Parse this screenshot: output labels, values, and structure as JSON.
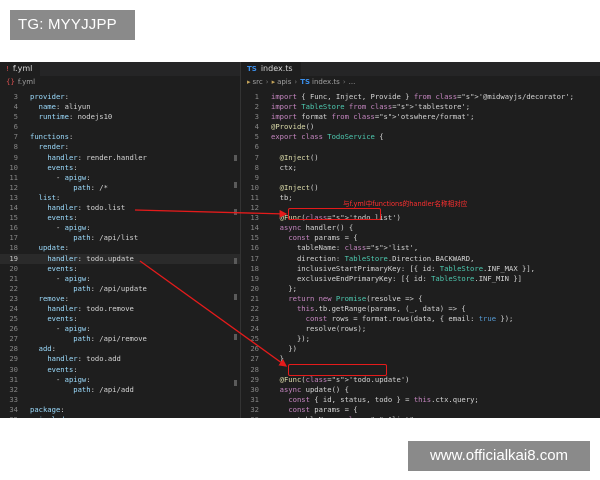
{
  "watermarks": {
    "top_left": "TG: MYYJJPP",
    "bottom_right": "www.officialkai8.com"
  },
  "left_editor": {
    "tab_label": "f.yml",
    "breadcrumb": "f.yml",
    "lines": [
      {
        "n": "3",
        "text": "provider:"
      },
      {
        "n": "4",
        "text": "  name: aliyun"
      },
      {
        "n": "5",
        "text": "  runtime: nodejs10"
      },
      {
        "n": "6",
        "text": ""
      },
      {
        "n": "7",
        "text": "functions:"
      },
      {
        "n": "8",
        "text": "  render:"
      },
      {
        "n": "9",
        "text": "    handler: render.handler"
      },
      {
        "n": "10",
        "text": "    events:"
      },
      {
        "n": "11",
        "text": "      - apigw:"
      },
      {
        "n": "12",
        "text": "          path: /*"
      },
      {
        "n": "13",
        "text": "  list:"
      },
      {
        "n": "14",
        "text": "    handler: todo.list"
      },
      {
        "n": "15",
        "text": "    events:"
      },
      {
        "n": "16",
        "text": "      - apigw:"
      },
      {
        "n": "17",
        "text": "          path: /api/list"
      },
      {
        "n": "18",
        "text": "  update:"
      },
      {
        "n": "19",
        "text": "    handler: todo.update"
      },
      {
        "n": "20",
        "text": "    events:"
      },
      {
        "n": "21",
        "text": "      - apigw:"
      },
      {
        "n": "22",
        "text": "          path: /api/update"
      },
      {
        "n": "23",
        "text": "  remove:"
      },
      {
        "n": "24",
        "text": "    handler: todo.remove"
      },
      {
        "n": "25",
        "text": "    events:"
      },
      {
        "n": "26",
        "text": "      - apigw:"
      },
      {
        "n": "27",
        "text": "          path: /api/remove"
      },
      {
        "n": "28",
        "text": "  add:"
      },
      {
        "n": "29",
        "text": "    handler: todo.add"
      },
      {
        "n": "30",
        "text": "    events:"
      },
      {
        "n": "31",
        "text": "      - apigw:"
      },
      {
        "n": "32",
        "text": "          path: /api/add"
      },
      {
        "n": "33",
        "text": ""
      },
      {
        "n": "34",
        "text": "package:"
      },
      {
        "n": "35",
        "text": "  include:"
      }
    ]
  },
  "right_editor": {
    "tab_label": "index.ts",
    "breadcrumb": {
      "src": "src",
      "apis": "apis",
      "file": "index.ts",
      "more": "..."
    },
    "annotation": "与f.yml中functions的handler名称相对应",
    "lines": [
      {
        "n": "1",
        "text": "import { Func, Inject, Provide } from '@midwayjs/decorator';"
      },
      {
        "n": "2",
        "text": "import TableStore from 'tablestore';"
      },
      {
        "n": "3",
        "text": "import format from 'otswhere/format';"
      },
      {
        "n": "4",
        "text": "@Provide()"
      },
      {
        "n": "5",
        "text": "export class TodoService {"
      },
      {
        "n": "6",
        "text": ""
      },
      {
        "n": "7",
        "text": "  @Inject()"
      },
      {
        "n": "8",
        "text": "  ctx;"
      },
      {
        "n": "9",
        "text": ""
      },
      {
        "n": "10",
        "text": "  @Inject()"
      },
      {
        "n": "11",
        "text": "  tb;"
      },
      {
        "n": "12",
        "text": ""
      },
      {
        "n": "13",
        "text": "  @Func('todo.list')"
      },
      {
        "n": "14",
        "text": "  async handler() {"
      },
      {
        "n": "15",
        "text": "    const params = {"
      },
      {
        "n": "16",
        "text": "      tableName: 'list',"
      },
      {
        "n": "17",
        "text": "      direction: TableStore.Direction.BACKWARD,"
      },
      {
        "n": "18",
        "text": "      inclusiveStartPrimaryKey: [{ id: TableStore.INF_MAX }],"
      },
      {
        "n": "19",
        "text": "      exclusiveEndPrimaryKey: [{ id: TableStore.INF_MIN }]"
      },
      {
        "n": "20",
        "text": "    };"
      },
      {
        "n": "21",
        "text": "    return new Promise(resolve => {"
      },
      {
        "n": "22",
        "text": "      this.tb.getRange(params, (_, data) => {"
      },
      {
        "n": "23",
        "text": "        const rows = format.rows(data, { email: true });"
      },
      {
        "n": "24",
        "text": "        resolve(rows);"
      },
      {
        "n": "25",
        "text": "      });"
      },
      {
        "n": "26",
        "text": "    })"
      },
      {
        "n": "27",
        "text": "  }"
      },
      {
        "n": "28",
        "text": ""
      },
      {
        "n": "29",
        "text": "  @Func('todo.update')"
      },
      {
        "n": "30",
        "text": "  async update() {"
      },
      {
        "n": "31",
        "text": "    const { id, status, todo } = this.ctx.query;"
      },
      {
        "n": "32",
        "text": "    const params = {"
      },
      {
        "n": "33",
        "text": "      tableName: \"list\","
      }
    ]
  },
  "colors": {
    "annotation_red": "#e51b1b",
    "editor_bg": "#1e1e1e"
  }
}
